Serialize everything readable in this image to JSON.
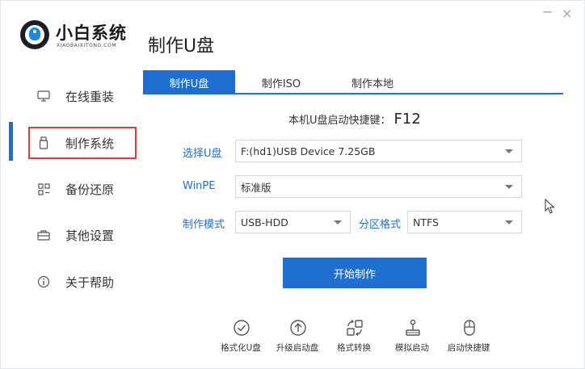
{
  "app": {
    "name": "小白系统",
    "subtitle": "XIAOBAIXITONG.COM"
  },
  "window": {
    "minimize_glyph": "−",
    "close_glyph": "×"
  },
  "page_title": "制作U盘",
  "sidebar": {
    "items": [
      {
        "label": "在线重装",
        "icon": "monitor-icon"
      },
      {
        "label": "制作系统",
        "icon": "usb-drive-icon",
        "active": true
      },
      {
        "label": "备份还原",
        "icon": "grid-icon"
      },
      {
        "label": "其他设置",
        "icon": "briefcase-icon"
      },
      {
        "label": "关于帮助",
        "icon": "info-icon"
      }
    ]
  },
  "tabs": [
    {
      "label": "制作U盘",
      "active": true
    },
    {
      "label": "制作ISO",
      "active": false
    },
    {
      "label": "制作本地",
      "active": false
    }
  ],
  "hotkey": {
    "label": "本机U盘启动快捷键：",
    "key": "F12"
  },
  "form": {
    "usb_label": "选择U盘",
    "usb_value": "F:(hd1)USB Device 7.25GB",
    "winpe_label": "WinPE",
    "winpe_value": "标准版",
    "mode_label": "制作模式",
    "mode_value": "USB-HDD",
    "partition_label": "分区格式",
    "partition_value": "NTFS"
  },
  "start_button": "开始制作",
  "tools": [
    {
      "label": "格式化U盘",
      "icon": "check-circle-icon"
    },
    {
      "label": "升级启动盘",
      "icon": "upgrade-icon"
    },
    {
      "label": "格式转换",
      "icon": "convert-icon"
    },
    {
      "label": "模拟启动",
      "icon": "joystick-icon"
    },
    {
      "label": "启动快捷键",
      "icon": "mouse-icon"
    }
  ],
  "colors": {
    "accent": "#1f6fd0",
    "highlight_border": "#e53935"
  }
}
